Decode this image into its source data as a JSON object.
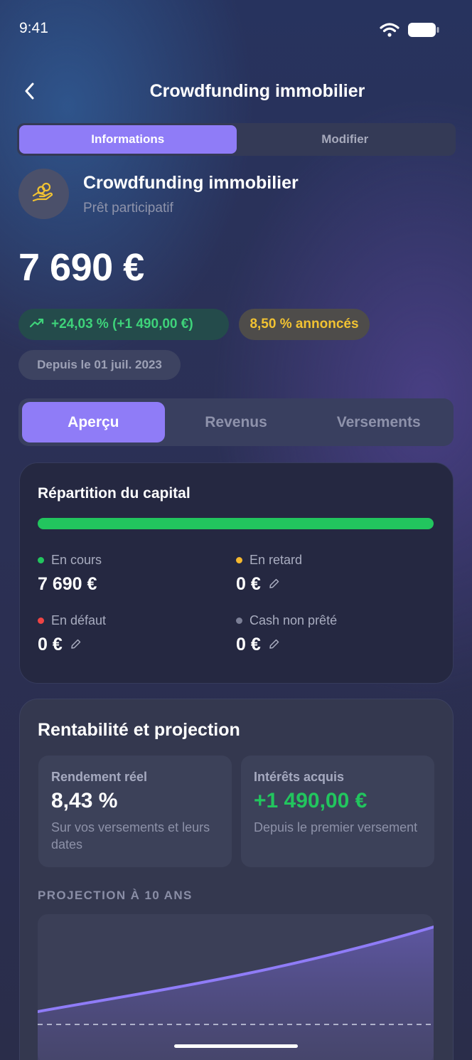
{
  "status_bar": {
    "time": "9:41",
    "wifi_icon": "wifi-icon",
    "battery_icon": "battery-icon"
  },
  "header": {
    "title": "Crowdfunding immobilier",
    "back_icon": "chevron-left-icon"
  },
  "top_segment": {
    "tabs": [
      "Informations",
      "Modifier"
    ],
    "active": "Informations"
  },
  "asset": {
    "icon": "hand-coins-icon",
    "name": "Crowdfunding immobilier",
    "type": "Prêt participatif",
    "amount": "7 690 €",
    "performance": "+24,03 % (+1 490,00 €)",
    "announced_rate": "8,50 % annoncés",
    "since": "Depuis le 01 juil. 2023"
  },
  "tabs": {
    "items": [
      "Aperçu",
      "Revenus",
      "Versements"
    ],
    "active": "Aperçu"
  },
  "capital": {
    "title": "Répartition du capital",
    "items": [
      {
        "label": "En cours",
        "value": "7 690 €",
        "color": "#22c55e",
        "editable": false
      },
      {
        "label": "En retard",
        "value": "0 €",
        "color": "#f5b82e",
        "editable": true
      },
      {
        "label": "En défaut",
        "value": "0 €",
        "color": "#ef4444",
        "editable": true
      },
      {
        "label": "Cash non prêté",
        "value": "0 €",
        "color": "#7b7f96",
        "editable": true
      }
    ],
    "bar_fraction_en_cours": 1.0
  },
  "rentabilite": {
    "title": "Rentabilité et projection",
    "rendement": {
      "label": "Rendement réel",
      "value": "8,43 %",
      "desc": "Sur vos versements et leurs dates"
    },
    "interets": {
      "label": "Intérêts acquis",
      "value": "+1 490,00 €",
      "desc": "Depuis le premier versement"
    },
    "projection_label": "PROJECTION À 10 ANS"
  },
  "colors": {
    "accent": "#8f7cf7",
    "positive": "#22c55e",
    "warning": "#f1c232"
  }
}
